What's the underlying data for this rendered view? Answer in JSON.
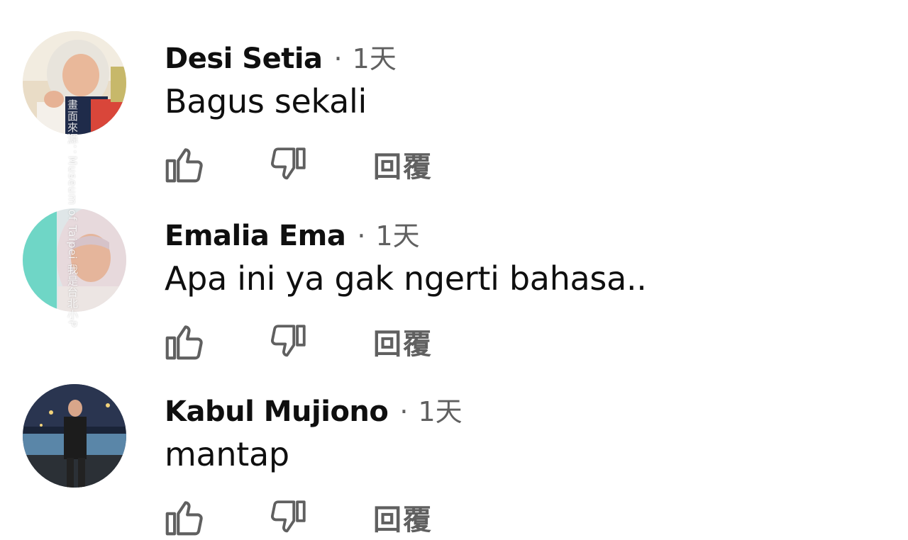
{
  "comments": [
    {
      "author": "Desi Setia",
      "separator": "·",
      "time": "1天",
      "text": "Bagus sekali",
      "reply_label": "回覆",
      "avatar_icon": "user-avatar-photo"
    },
    {
      "author": "Emalia Ema",
      "separator": "·",
      "time": "1天",
      "text": "Apa ini ya gak ngerti bahasa..",
      "reply_label": "回覆",
      "avatar_icon": "user-avatar-photo"
    },
    {
      "author": "Kabul Mujiono",
      "separator": "·",
      "time": "1天",
      "text": "mantap",
      "reply_label": "回覆",
      "avatar_icon": "user-avatar-photo"
    }
  ],
  "watermark": {
    "text": "畫面來源：Museum of Taipei 我是台北小P"
  },
  "colors": {
    "text_primary": "#0f0f0f",
    "text_secondary": "#606060",
    "icon": "#606060",
    "background": "#ffffff"
  },
  "icons": {
    "like": "thumbs-up-outline-icon",
    "dislike": "thumbs-down-outline-icon"
  }
}
